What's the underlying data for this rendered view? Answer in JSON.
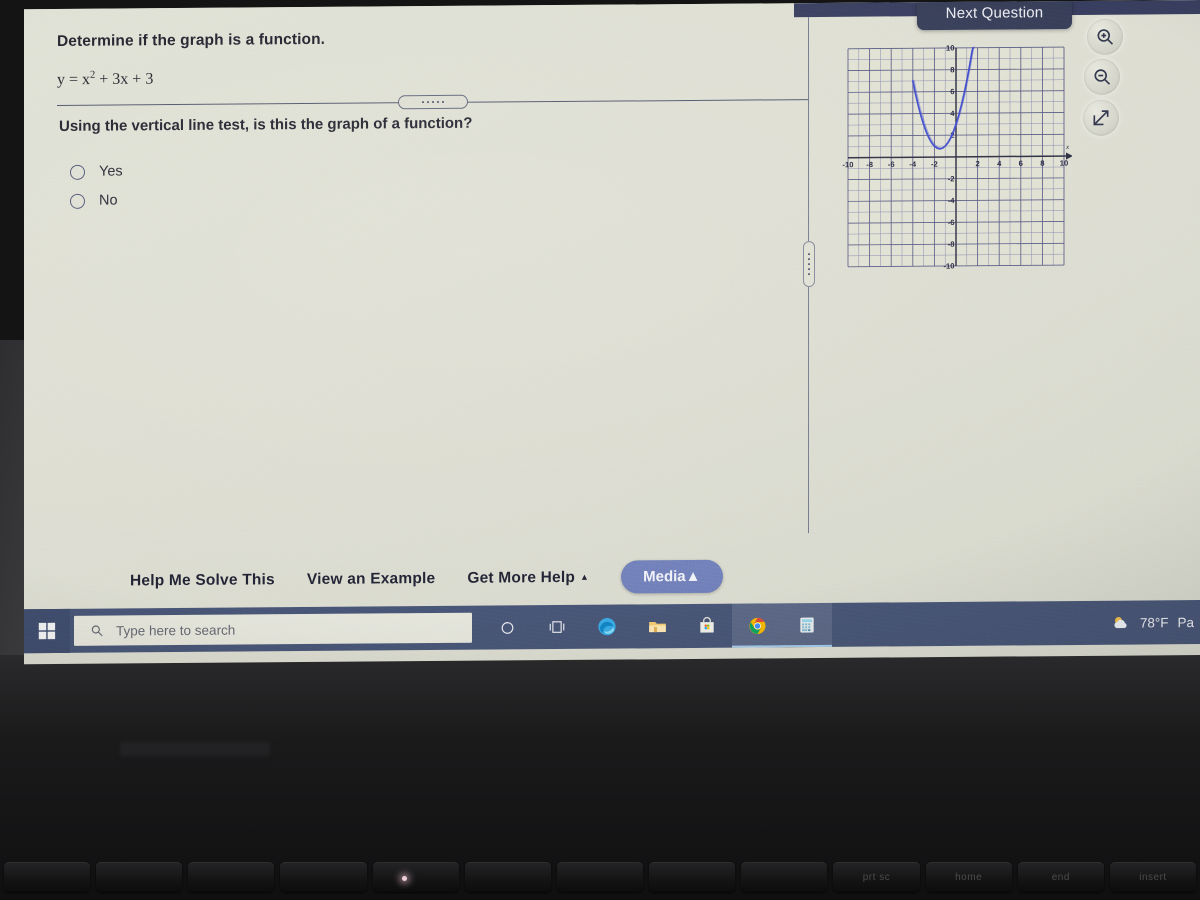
{
  "question": {
    "title": "Determine if the graph is a function.",
    "equation_html": "y = x<sup>2</sup> + 3x + 3",
    "equation_plain": "y = x^2 + 3x + 3",
    "prompt": "Using the vertical line test, is this the graph of a function?",
    "options": [
      {
        "label": "Yes",
        "selected": false
      },
      {
        "label": "No",
        "selected": false
      }
    ]
  },
  "header": {
    "next_question_label": "Next Question"
  },
  "tools": [
    {
      "name": "zoom-in-icon",
      "title": "Zoom In"
    },
    {
      "name": "zoom-out-icon",
      "title": "Zoom Out"
    },
    {
      "name": "expand-icon",
      "title": "Open in new window"
    }
  ],
  "help_bar": {
    "help_me_solve": "Help Me Solve This",
    "view_example": "View an Example",
    "get_more_help": "Get More Help",
    "get_more_help_caret": "▲",
    "media": "Media",
    "media_caret": "▲"
  },
  "colors": {
    "page_background": "#dcdccf",
    "taskbar": "#44506e",
    "media_pill": "#6b78b4",
    "next_question": "#343a52",
    "curve": "#3c46c8",
    "grid": "#6e6fa0",
    "axis": "#2a2a3c"
  },
  "taskbar": {
    "start_icon": "windows-logo-icon",
    "search_placeholder": "Type here to search",
    "search_icon": "search-icon",
    "icons": [
      {
        "name": "cortana-icon",
        "glyph": "◯"
      },
      {
        "name": "task-view-icon",
        "glyph": "▯"
      },
      {
        "name": "edge-browser-icon",
        "glyph": "e"
      },
      {
        "name": "file-explorer-icon",
        "glyph": "🗀"
      },
      {
        "name": "microsoft-store-icon",
        "glyph": "🛍"
      },
      {
        "name": "chrome-browser-icon",
        "glyph": "◉"
      },
      {
        "name": "calculator-icon",
        "glyph": "🖩"
      }
    ],
    "weather_temp": "78°F",
    "weather_desc": "Pa",
    "weather_icon": "partly-cloudy-icon"
  },
  "keyboard": {
    "keys": [
      "",
      "",
      "",
      "",
      "",
      "",
      "",
      "",
      "",
      "prt sc",
      "home",
      "end",
      "insert"
    ]
  },
  "chart_data": {
    "type": "line",
    "title": "",
    "xlabel": "x",
    "ylabel": "",
    "xlim": [
      -10,
      10
    ],
    "ylim": [
      -10,
      10
    ],
    "grid": true,
    "grid_step": 1,
    "x_ticks": [
      -10,
      -8,
      -6,
      -4,
      -2,
      2,
      4,
      6,
      8,
      10
    ],
    "y_ticks": [
      10,
      8,
      6,
      4,
      2,
      -2,
      -4,
      -6,
      -8,
      -10
    ],
    "x_axis_arrow": true,
    "series": [
      {
        "name": "y = x^2 + 3x + 3",
        "equation": "y = x^2 + 3x + 3",
        "vertex": [
          -1.5,
          0.75
        ],
        "color": "#3c46c8",
        "points": [
          [
            -4.0,
            7.0
          ],
          [
            -3.75,
            5.81
          ],
          [
            -3.5,
            4.75
          ],
          [
            -3.25,
            3.81
          ],
          [
            -3.0,
            3.0
          ],
          [
            -2.75,
            2.31
          ],
          [
            -2.5,
            1.75
          ],
          [
            -2.25,
            1.31
          ],
          [
            -2.0,
            1.0
          ],
          [
            -1.75,
            0.81
          ],
          [
            -1.5,
            0.75
          ],
          [
            -1.25,
            0.81
          ],
          [
            -1.0,
            1.0
          ],
          [
            -0.75,
            1.31
          ],
          [
            -0.5,
            1.75
          ],
          [
            -0.25,
            2.31
          ],
          [
            0.0,
            3.0
          ],
          [
            0.25,
            3.81
          ],
          [
            0.5,
            4.75
          ],
          [
            0.75,
            5.81
          ],
          [
            1.0,
            7.0
          ],
          [
            1.25,
            8.31
          ],
          [
            1.5,
            9.75
          ],
          [
            1.58,
            10.0
          ]
        ]
      }
    ]
  }
}
